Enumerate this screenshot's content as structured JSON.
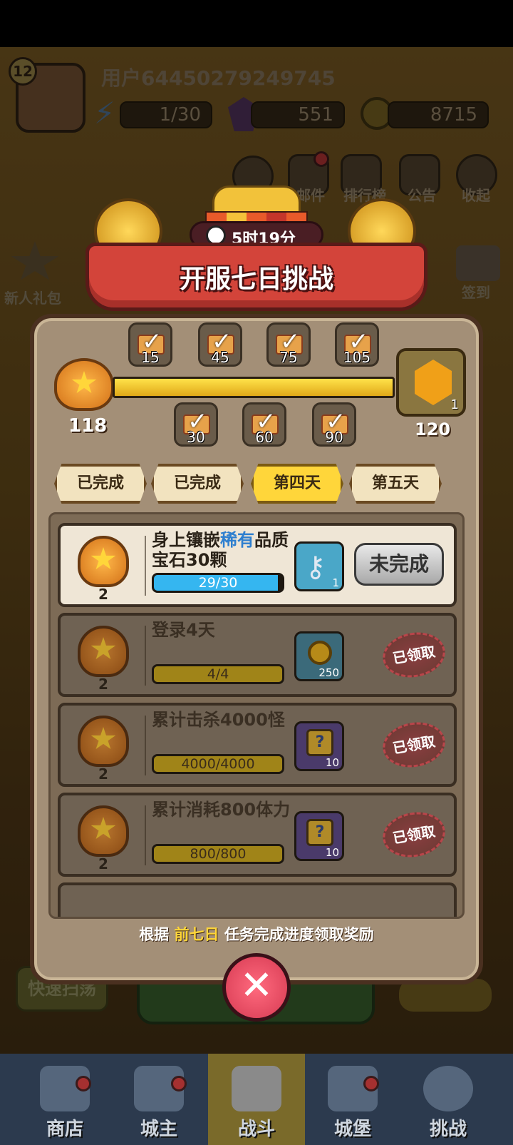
{
  "player": {
    "level": "12",
    "username": "用户64450279249745",
    "energy": "1/30",
    "gems": "551",
    "coins": "8715"
  },
  "top_menu": [
    "邮件",
    "排行榜",
    "公告",
    "收起"
  ],
  "side_left": [
    "新人礼包"
  ],
  "side_right": [
    "签到"
  ],
  "event": {
    "timer": "5时19分",
    "title": "开服七日挑战",
    "current_points": "118",
    "max_points": "120",
    "final_reward_count": "1",
    "progress_fraction": 1.0,
    "milestones_top": [
      "15",
      "45",
      "75",
      "105"
    ],
    "milestones_bottom": [
      "30",
      "60",
      "90"
    ]
  },
  "tabs": [
    "已完成",
    "已完成",
    "第四天",
    "第五天"
  ],
  "tasks": [
    {
      "title_part1": "身上镶嵌",
      "title_rare": "稀有",
      "title_part2": "品质宝石30颗",
      "medal": "2",
      "progress": "29/30",
      "progress_fraction": 0.967,
      "reward_count": "1",
      "reward_icon": "key-icon",
      "status": "未完成"
    },
    {
      "title": "登录4天",
      "medal": "2",
      "progress": "4/4",
      "progress_fraction": 1.0,
      "reward_count": "250",
      "reward_icon": "coin-icon",
      "status": "已领取"
    },
    {
      "title": "累计击杀4000怪",
      "medal": "2",
      "progress": "4000/4000",
      "progress_fraction": 1.0,
      "reward_count": "10",
      "reward_icon": "puzzle-icon",
      "status": "已领取"
    },
    {
      "title": "累计消耗800体力",
      "medal": "2",
      "progress": "800/800",
      "progress_fraction": 1.0,
      "reward_count": "10",
      "reward_icon": "puzzle-icon",
      "status": "已领取"
    }
  ],
  "footer": {
    "prefix": "根据",
    "highlight": "前七日",
    "suffix": "任务完成进度领取奖励"
  },
  "behind_buttons": {
    "quick_sweep": "快速扫荡"
  },
  "bottom_nav": [
    "商店",
    "城主",
    "战斗",
    "城堡",
    "挑战"
  ],
  "colors": {
    "progress_blue": "#35b6f0",
    "progress_gold": "#d9b01a",
    "tab_selected": "#ffd63a",
    "close_button": "#e84b62",
    "stamp_red": "#b9454a"
  }
}
